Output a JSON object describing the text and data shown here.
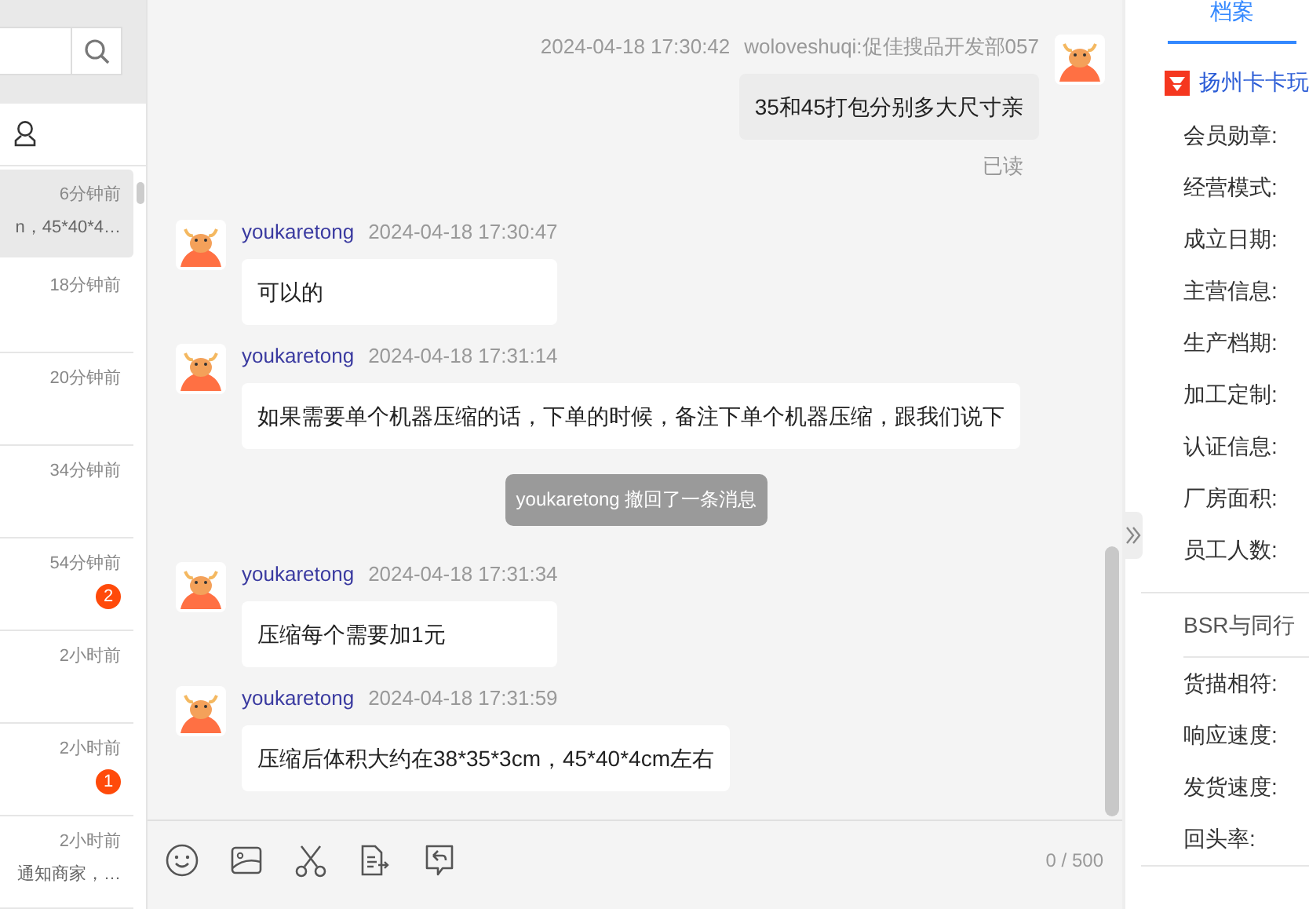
{
  "conversation_list": {
    "items": [
      {
        "time": "6分钟前",
        "preview": "n，45*40*4…",
        "selected": true
      },
      {
        "time": "18分钟前",
        "selected": false
      },
      {
        "time": "20分钟前",
        "selected": false
      },
      {
        "time": "34分钟前",
        "selected": false
      },
      {
        "time": "54分钟前",
        "badge": "2",
        "selected": false
      },
      {
        "time": "2小时前",
        "selected": false
      },
      {
        "time": "2小时前",
        "badge": "1",
        "selected": false
      },
      {
        "time": "2小时前",
        "preview": "通知商家，…",
        "selected": false
      }
    ]
  },
  "messages": [
    {
      "kind": "outgoing",
      "time": "2024-04-18 17:30:42",
      "sender": "woloveshuqi:促佳搜品开发部057",
      "text": "35和45打包分别多大尺寸亲",
      "receipt": "已读"
    },
    {
      "kind": "incoming",
      "sender": "youkaretong",
      "time": "2024-04-18 17:30:47",
      "text": "可以的"
    },
    {
      "kind": "incoming",
      "sender": "youkaretong",
      "time": "2024-04-18 17:31:14",
      "text": "如果需要单个机器压缩的话，下单的时候，备注下单个机器压缩，跟我们说下"
    },
    {
      "kind": "recall",
      "text": "youkaretong 撤回了一条消息"
    },
    {
      "kind": "incoming",
      "sender": "youkaretong",
      "time": "2024-04-18 17:31:34",
      "text": "压缩每个需要加1元"
    },
    {
      "kind": "incoming",
      "sender": "youkaretong",
      "time": "2024-04-18 17:31:59",
      "text": "压缩后体积大约在38*35*3cm，45*40*4cm左右"
    }
  ],
  "composer": {
    "counter": "0 / 500"
  },
  "profile": {
    "tab": {
      "label": "档案",
      "selected": true
    },
    "shop_name": "扬州卡卡玩",
    "fields": [
      "会员勋章:",
      "经营模式:",
      "成立日期:",
      "主营信息:",
      "生产档期:",
      "加工定制:",
      "认证信息:",
      "厂房面积:",
      "员工人数:"
    ],
    "section_title": "BSR与同行",
    "ratings": [
      "货描相符:",
      "响应速度:",
      "发货速度:",
      "回头率:"
    ]
  }
}
